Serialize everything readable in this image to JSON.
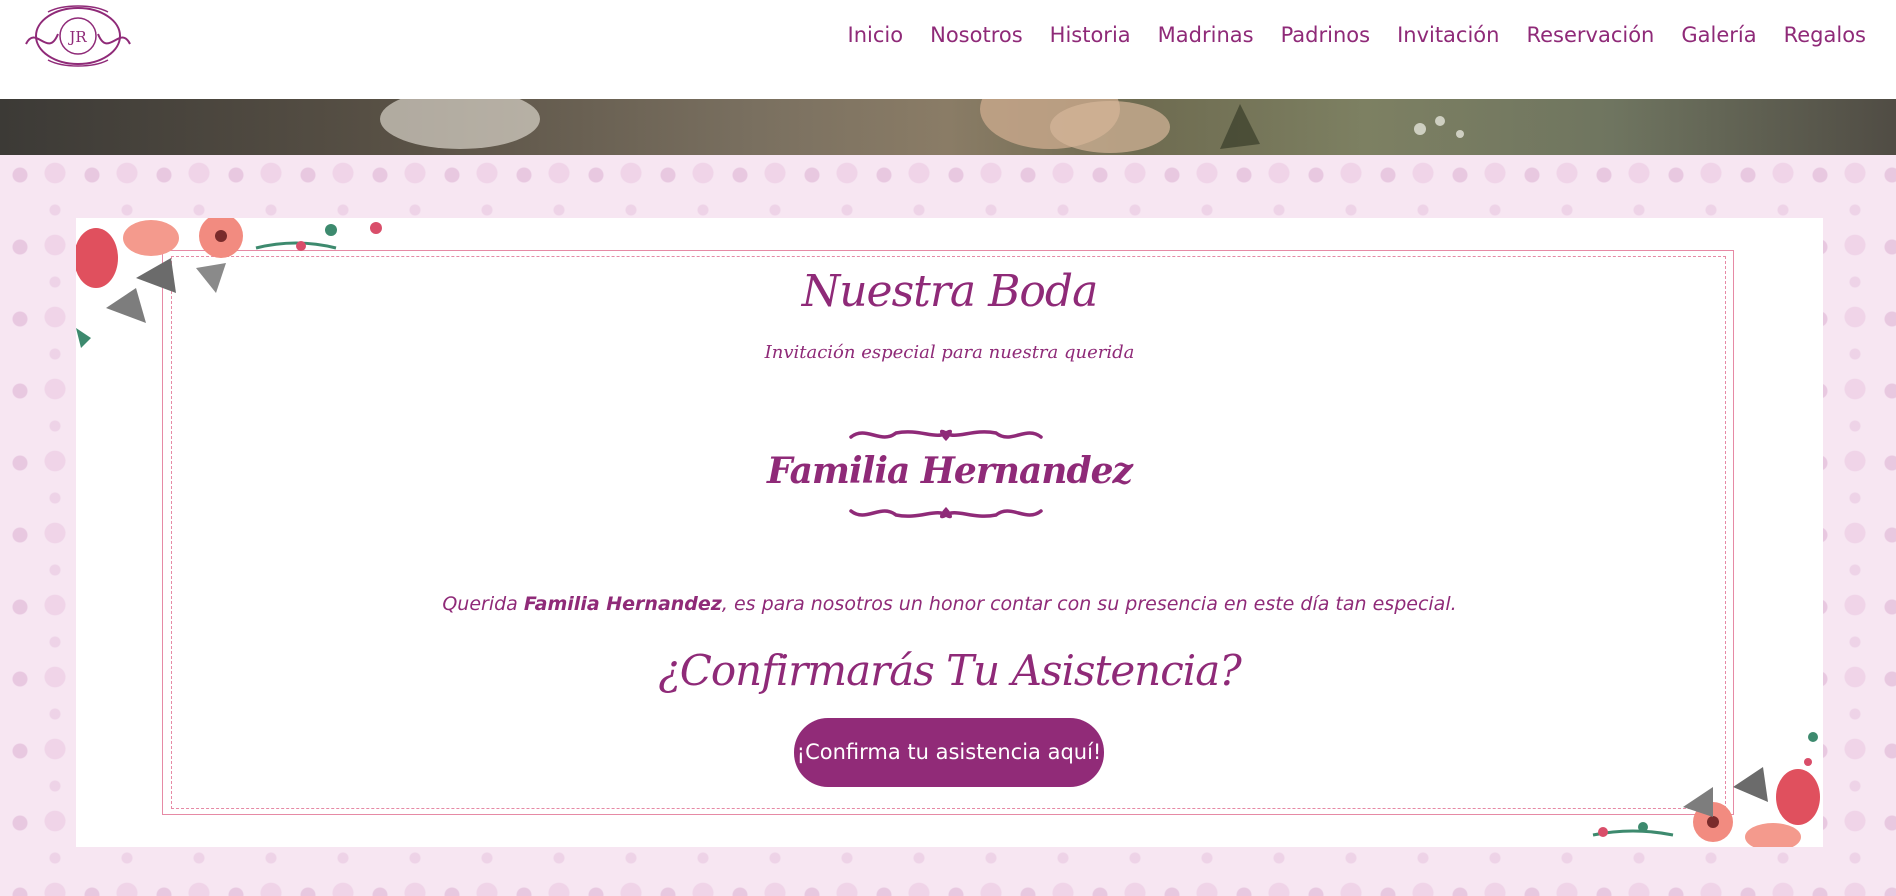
{
  "brand": {
    "logo_text": "JR",
    "accent_color": "#8f2a78",
    "frame_color": "#e68aa5"
  },
  "nav": {
    "items": [
      {
        "label": "Inicio"
      },
      {
        "label": "Nosotros"
      },
      {
        "label": "Historia"
      },
      {
        "label": "Madrinas"
      },
      {
        "label": "Padrinos"
      },
      {
        "label": "Invitación"
      },
      {
        "label": "Reservación"
      },
      {
        "label": "Galería"
      },
      {
        "label": "Regalos"
      }
    ]
  },
  "invitation": {
    "title": "Nuestra Boda",
    "subtitle": "Invitación especial para nuestra querida",
    "family_name": "Familia Hernandez",
    "message_prefix": "Querida ",
    "message_name": "Familia Hernandez",
    "message_suffix": ", es para nosotros un honor contar con su presencia en este día tan especial.",
    "confirm_heading": "¿Confirmarás Tu Asistencia?",
    "confirm_button": "¡Confirma tu asistencia aquí!"
  }
}
